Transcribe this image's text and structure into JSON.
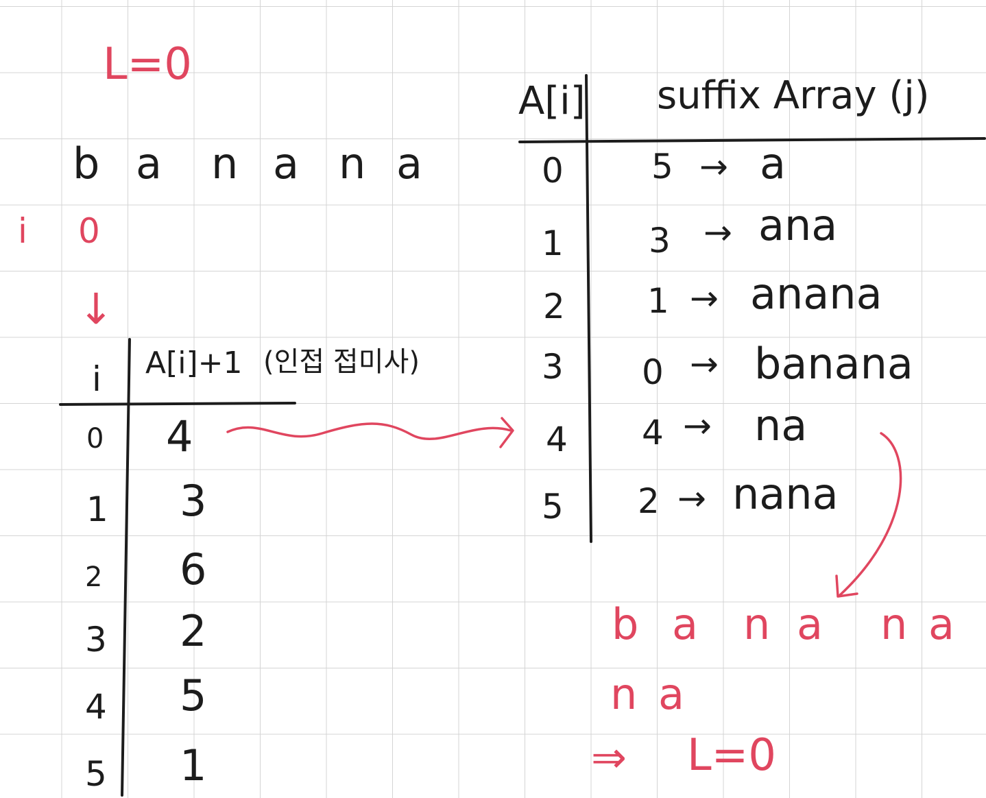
{
  "top_note": "L=0",
  "word": [
    "b",
    "a",
    "n",
    "a",
    "n",
    "a"
  ],
  "i_label": "i",
  "i_value": "0",
  "down_arrow": "↓",
  "left_table": {
    "col_i": "i",
    "col_value": "A[i]+1",
    "col_note": "(인접 접미사)",
    "rows": [
      {
        "i": "0",
        "v": "4"
      },
      {
        "i": "1",
        "v": "3"
      },
      {
        "i": "2",
        "v": "6"
      },
      {
        "i": "3",
        "v": "2"
      },
      {
        "i": "4",
        "v": "5"
      },
      {
        "i": "5",
        "v": "1"
      }
    ]
  },
  "right_table": {
    "col_index": "A[i]",
    "col_suffix": "suffix Array (j)",
    "rows": [
      {
        "idx": "0",
        "j": "5",
        "arrow": "→",
        "suffix": "a"
      },
      {
        "idx": "1",
        "j": "3",
        "arrow": "→",
        "suffix": "ana"
      },
      {
        "idx": "2",
        "j": "1",
        "arrow": "→",
        "suffix": "anana"
      },
      {
        "idx": "3",
        "j": "0",
        "arrow": "→",
        "suffix": "banana"
      },
      {
        "idx": "4",
        "j": "4",
        "arrow": "→",
        "suffix": "na"
      },
      {
        "idx": "5",
        "j": "2",
        "arrow": "→",
        "suffix": "nana"
      }
    ]
  },
  "compare": {
    "line1": [
      "b",
      "a",
      "n",
      "a",
      "n",
      "a"
    ],
    "line2": [
      "n",
      "a"
    ],
    "result_arrow": "⇒",
    "result": "L=0"
  },
  "colors": {
    "ink": "#1c1c1c",
    "accent": "#e0465f"
  }
}
